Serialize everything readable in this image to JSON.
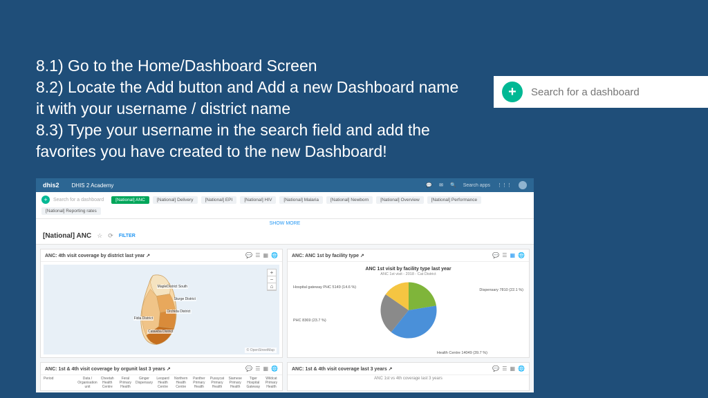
{
  "instructions": {
    "line1": "8.1) Go to the Home/Dashboard Screen",
    "line2": "8.2) Locate the Add button and Add a new Dashboard name it with your username / district name",
    "line3": "8.3) Type your username in the search field and add the favorites you have created to the new Dashboard!"
  },
  "top_search": {
    "placeholder": "Search for a dashboard"
  },
  "app": {
    "logo": "dhis2",
    "title": "DHIS 2 Academy",
    "search_apps": "Search apps"
  },
  "chipbar": {
    "mini_search": "Search for a dashboard",
    "chips": [
      "[National] ANC",
      "[National] Delivery",
      "[National] EPI",
      "[National] HIV",
      "[National] Malaria",
      "[National] Newborn",
      "[National] Overview",
      "[National] Performance",
      "[National] Reporting rates"
    ],
    "showmore": "SHOW MORE"
  },
  "dash_title": {
    "title": "[National] ANC",
    "filter": "FILTER"
  },
  "card_map": {
    "title": "ANC: 4th visit coverage by district last year ↗",
    "attrib": "© OpenStreetMap",
    "labels": [
      "MapleDistrict South",
      "Sturge District",
      "Orchida District",
      "Fidia District",
      "Catawba District"
    ]
  },
  "card_pie": {
    "title": "ANC: ANC 1st by facility type ↗",
    "chart_title": "ANC 1st visit by facility type last year",
    "chart_sub": "ANC 1st visit - 2018 - Cat District",
    "labels": {
      "dispensary": "Dispensary\n7810 (22.1 %)",
      "gateway": "Hospital gateway PHC\n5149 (14.6 %)",
      "phc": "PHC\n8369 (23.7 %)",
      "health_centre": "Health Centre\n14049 (39.7 %)"
    }
  },
  "card_bl": {
    "title": "ANC: 1st & 4th visit coverage by orgunit last 3 years ↗"
  },
  "card_br": {
    "title": "ANC: 1st & 4th visit coverage last 3 years ↗",
    "sub": "ANC 1st vs 4th coverage last 3 years"
  },
  "table_cols": [
    "Period",
    "Data / Organisation unit",
    "Cheetah Health Centre",
    "Feral Primary Health",
    "Ginger Dispensary",
    "Leopard Health Centre",
    "Northern Health Centre",
    "Panther Primary Health",
    "Pussycat Primary Health",
    "Siamese Primary Health",
    "Tiger Hospital Gateway",
    "Wildcat Primary Health"
  ],
  "chart_data": {
    "type": "pie",
    "title": "ANC 1st visit by facility type last year",
    "series": [
      {
        "name": "Dispensary",
        "value": 7810,
        "pct": 22.1,
        "color": "#7fb53a"
      },
      {
        "name": "Health Centre",
        "value": 14049,
        "pct": 39.7,
        "color": "#4a90d9"
      },
      {
        "name": "PHC",
        "value": 8369,
        "pct": 23.7,
        "color": "#8a8a8a"
      },
      {
        "name": "Hospital gateway PHC",
        "value": 5149,
        "pct": 14.6,
        "color": "#f5c542"
      }
    ]
  }
}
